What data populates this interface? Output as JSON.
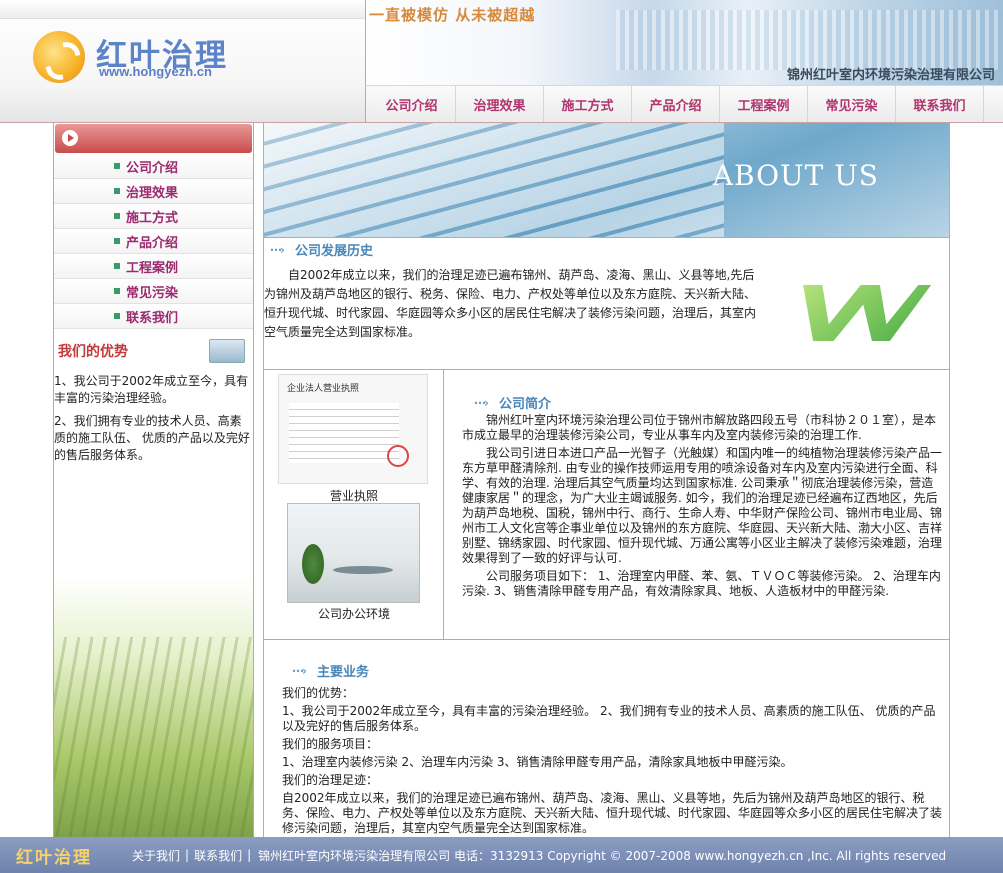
{
  "header": {
    "logo_name": "红叶治理",
    "logo_url": "www.hongyezh.cn",
    "slogan": "一直被模仿  从未被超越",
    "company": "锦州红叶室内环境污染治理有限公司"
  },
  "nav": [
    "公司介绍",
    "治理效果",
    "施工方式",
    "产品介绍",
    "工程案例",
    "常见污染",
    "联系我们"
  ],
  "sidebar": {
    "items": [
      "公司介绍",
      "治理效果",
      "施工方式",
      "产品介绍",
      "工程案例",
      "常见污染",
      "联系我们"
    ],
    "advantage_title": "我们的优势",
    "advantage_1": "1、我公司于2002年成立至今，具有丰富的污染治理经验。",
    "advantage_2": "2、我们拥有专业的技术人员、高素质的施工队伍、 优质的产品以及完好的售后服务体系。"
  },
  "main": {
    "banner_title": "ABOUT US",
    "history_title": "公司发展历史",
    "history_text": "自2002年成立以来，我们的治理足迹已遍布锦州、葫芦岛、凌海、黑山、义县等地,先后为锦州及葫芦岛地区的银行、税务、保险、电力、产权处等单位以及东方庭院、天兴新大陆、恒升现代城、时代家园、华庭园等众多小区的居民住宅解决了装修污染问题，治理后，其室内空气质量完全达到国家标准。",
    "license_header": "企业法人营业执照",
    "license_label": "营业执照",
    "office_label": "公司办公环境",
    "intro_title": "公司简介",
    "intro_p1": "锦州红叶室内环境污染治理公司位于锦州市解放路四段五号（市科协２０１室），是本市成立最早的治理装修污染公司，专业从事车内及室内装修污染的治理工作.",
    "intro_p2": "我公司引进日本进口产品一光智子（光触媒）和国内唯一的纯植物治理装修污染产品一东方草甲醛清除剂. 由专业的操作技师运用专用的喷涂设备对车内及室内污染进行全面、科学、有效的治理. 治理后其空气质量均达到国家标准. 公司秉承＂彻底治理装修污染，营造健康家居＂的理念，为广大业主竭诚服务. 如今，我们的治理足迹已经遍布辽西地区，先后为葫芦岛地税、国税，锦州中行、商行、生命人寿、中华财产保险公司、锦州市电业局、锦州市工人文化宫等企事业单位以及锦州的东方庭院、华庭园、天兴新大陆、渤大小区、吉祥别墅、锦绣家园、时代家园、恒升现代城、万通公寓等小区业主解决了装修污染难题，治理效果得到了一致的好评与认可.",
    "intro_p3": "公司服务项目如下： 1、治理室内甲醛、苯、氨、ＴＶＯＣ等装修污染。 2、治理车内污染. 3、销售清除甲醛专用产品，有效清除家具、地板、人造板材中的甲醛污染.",
    "biz_title": "主要业务",
    "biz_adv_label": "我们的优势：",
    "biz_adv_text": "1、我公司于2002年成立至今，具有丰富的污染治理经验。  2、我们拥有专业的技术人员、高素质的施工队伍、  优质的产品以及完好的售后服务体系。",
    "biz_service_label": "我们的服务项目：",
    "biz_service_text": "1、治理室内装修污染 2、治理车内污染 3、销售清除甲醛专用产品，清除家具地板中甲醛污染。",
    "biz_track_label": "我们的治理足迹：",
    "biz_track_text": "自2002年成立以来，我们的治理足迹已遍布锦州、葫芦岛、凌海、黑山、义县等地，先后为锦州及葫芦岛地区的银行、税务、保险、电力、产权处等单位以及东方庭院、天兴新大陆、恒升现代城、时代家园、华庭园等众多小区的居民住宅解决了装修污染问题，治理后，其室内空气质量完全达到国家标准。"
  },
  "footer": {
    "logo": "红叶治理",
    "link_about": "关于我们",
    "link_contact": "联系我们",
    "copyright": "锦州红叶室内环境污染治理有限公司  电话：3132913 Copyright © 2007-2008 www.hongyezh.cn ,Inc. All rights reserved"
  }
}
